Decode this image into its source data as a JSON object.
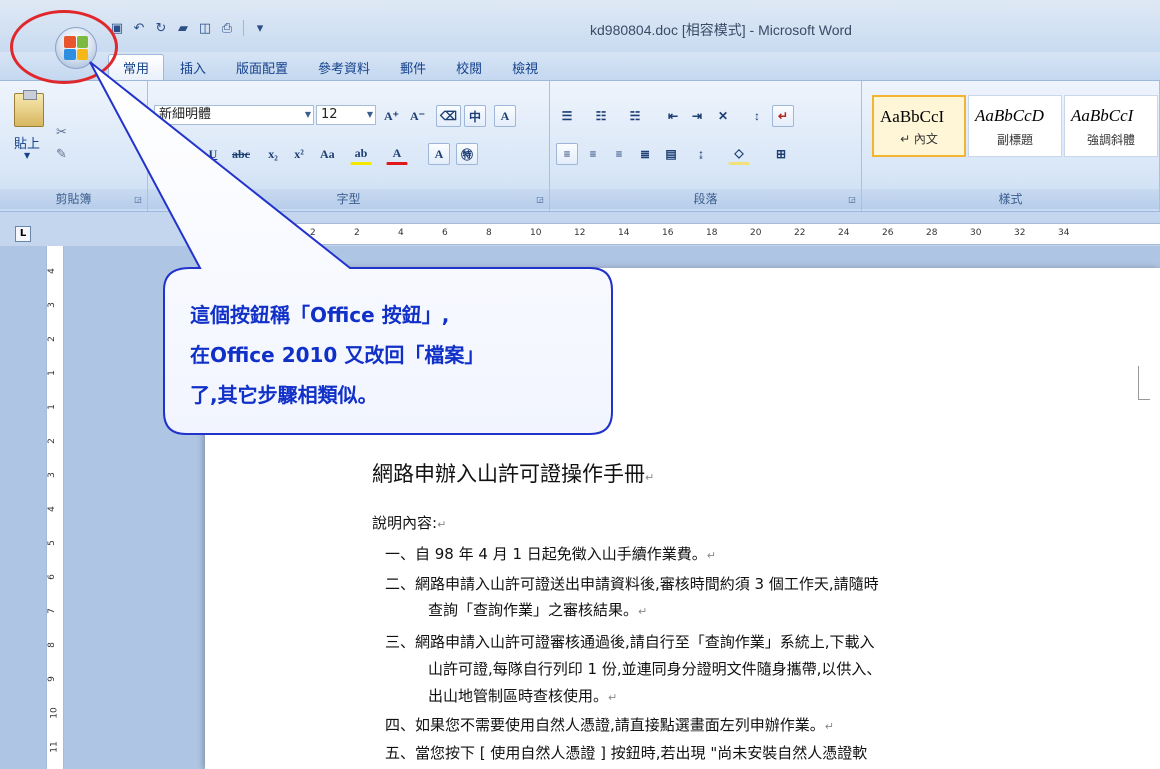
{
  "window": {
    "title": "kd980804.doc [相容模式] - Microsoft Word"
  },
  "tabs": [
    {
      "label": "常用",
      "active": true
    },
    {
      "label": "插入"
    },
    {
      "label": "版面配置"
    },
    {
      "label": "參考資料"
    },
    {
      "label": "郵件"
    },
    {
      "label": "校閱"
    },
    {
      "label": "檢視"
    }
  ],
  "clipboard": {
    "paste_label": "貼上",
    "group_label": "剪貼簿"
  },
  "font": {
    "name": "新細明體",
    "size": "12",
    "group_label": "字型"
  },
  "paragraph": {
    "group_label": "段落"
  },
  "styles": {
    "group_label": "樣式",
    "items": [
      {
        "sample": "AaBbCcI",
        "name": "↵ 內文",
        "active": true
      },
      {
        "sample": "AaBbCcD",
        "name": "副標題"
      },
      {
        "sample": "AaBbCcI",
        "name": "強調斜體"
      }
    ]
  },
  "ruler": {
    "ticks": [
      "2",
      "2",
      "4",
      "6",
      "8",
      "10",
      "12",
      "14",
      "16",
      "18",
      "20",
      "22",
      "24",
      "26",
      "28",
      "30",
      "32",
      "34"
    ],
    "vticks": [
      "4",
      "3",
      "2",
      "1",
      "1",
      "2",
      "3",
      "4",
      "5",
      "6",
      "7",
      "8",
      "9",
      "10",
      "11"
    ]
  },
  "callout": {
    "line1": "這個按鈕稱「Office 按鈕」,",
    "line2": "在Office 2010 又改回「檔案」",
    "line3": "了,其它步驟相類似。"
  },
  "document": {
    "heading": "網路申辦入山許可證操作手冊",
    "intro": "說明內容:",
    "items": [
      {
        "text": "一、自 98 年 4 月 1 日起免徵入山手續作業費。"
      },
      {
        "text": "二、網路申請入山許可證送出申請資料後,審核時間約須 3 個工作天,請隨時",
        "cont": [
          "查詢「查詢作業」之審核結果。"
        ]
      },
      {
        "text": "三、網路申請入山許可證審核通過後,請自行至「查詢作業」系統上,下載入",
        "cont": [
          "山許可證,每隊自行列印 1 份,並連同身分證明文件隨身攜帶,以供入、",
          "出山地管制區時查核使用。"
        ]
      },
      {
        "text": "四、如果您不需要使用自然人憑證,請直接點選畫面左列申辦作業。"
      },
      {
        "text": "五、當您按下 [ 使用自然人憑證 ] 按鈕時,若出現 \"尚未安裝自然人憑證軟"
      }
    ],
    "paragraph_mark": "↵"
  },
  "colors": {
    "callout_text": "#1030c8",
    "callout_border": "#2233cc",
    "highlight_circle": "#e0282c"
  }
}
